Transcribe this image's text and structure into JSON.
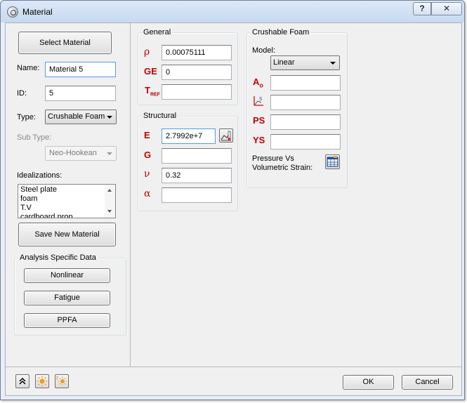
{
  "window": {
    "title": "Material",
    "help_label": "?",
    "close_label": "✕"
  },
  "left": {
    "select_material_label": "Select Material",
    "name_label": "Name:",
    "name_value": "Material 5",
    "id_label": "ID:",
    "id_value": "5",
    "type_label": "Type:",
    "type_value": "Crushable Foam",
    "subtype_label": "Sub Type:",
    "subtype_value": "Neo-Hookean",
    "idealizations_label": "Idealizations:",
    "idealizations": [
      "Steel plate",
      "foam",
      "T.V",
      "cardboard prop"
    ],
    "save_new_label": "Save New Material",
    "analysis_group_title": "Analysis Specific Data",
    "analysis_buttons": [
      "Nonlinear",
      "Fatigue",
      "PPFA"
    ]
  },
  "general": {
    "title": "General",
    "rows": [
      {
        "symbol": "ρ",
        "value": "0.00075111"
      },
      {
        "symbol": "GE",
        "value": "0"
      },
      {
        "symbol": "T",
        "symbol_sub": "REF",
        "value": ""
      }
    ]
  },
  "structural": {
    "title": "Structural",
    "rows": [
      {
        "symbol": "E",
        "value": "2.7992e+7"
      },
      {
        "symbol": "G",
        "value": ""
      },
      {
        "symbol": "ν",
        "value": "0.32"
      },
      {
        "symbol": "α",
        "value": ""
      }
    ],
    "table_icon": "temperature-chart-icon"
  },
  "crushable": {
    "title": "Crushable Foam",
    "model_label": "Model:",
    "model_value": "Linear",
    "rows": [
      {
        "symbol": "A",
        "symbol_sub": "o",
        "value": ""
      },
      {
        "symbol": "",
        "icon": "stress-strain-chart-icon",
        "value": ""
      },
      {
        "symbol": "PS",
        "value": ""
      },
      {
        "symbol": "YS",
        "value": ""
      }
    ],
    "pressure_label_1": "Pressure Vs",
    "pressure_label_2": "Volumetric Strain:",
    "pressure_icon": "table-edit-icon"
  },
  "bottom": {
    "ok_label": "OK",
    "cancel_label": "Cancel",
    "icons": [
      "collapse-up-icon",
      "sun-icon",
      "sun-multi-icon"
    ]
  },
  "colors": {
    "symbol_red": "#c00000",
    "window_frame": "#c7d9f0",
    "dialog_bg": "#f0f0f0"
  }
}
